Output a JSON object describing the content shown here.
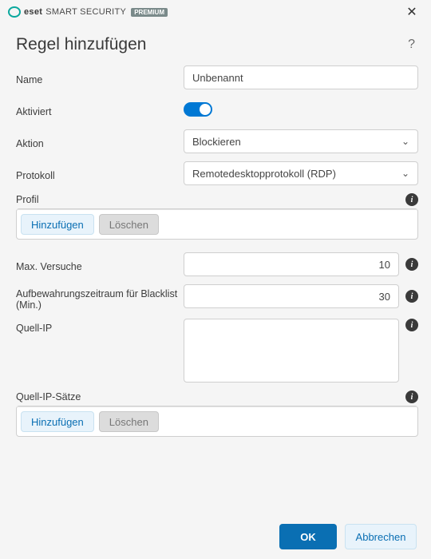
{
  "brand": {
    "eset": "eset",
    "product": "SMART SECURITY",
    "badge": "PREMIUM"
  },
  "page": {
    "title": "Regel hinzufügen"
  },
  "form": {
    "name_label": "Name",
    "name_value": "Unbenannt",
    "enabled_label": "Aktiviert",
    "enabled_value": true,
    "action_label": "Aktion",
    "action_selected": "Blockieren",
    "protocol_label": "Protokoll",
    "protocol_selected": "Remotedesktopprotokoll (RDP)",
    "profile_label": "Profil",
    "max_attempts_label": "Max. Versuche",
    "max_attempts_value": "10",
    "blacklist_label": "Aufbewahrungszeitraum für Blacklist (Min.)",
    "blacklist_value": "30",
    "source_ip_label": "Quell-IP",
    "source_ip_sets_label": "Quell-IP-Sätze"
  },
  "buttons": {
    "add": "Hinzufügen",
    "delete": "Löschen",
    "ok": "OK",
    "cancel": "Abbrechen"
  }
}
